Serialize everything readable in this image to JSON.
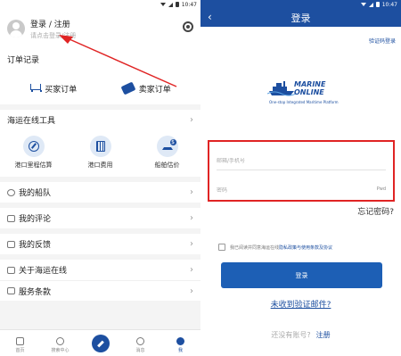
{
  "status_bar": {
    "time": "10:47"
  },
  "left": {
    "profile": {
      "login_label": "登录 / 注册",
      "hint": "请点击登录/注册"
    },
    "orders": {
      "title": "订单记录",
      "buy_label": "买家订单",
      "sell_label": "卖家订单"
    },
    "tools": {
      "title": "海运在线工具",
      "items": [
        {
          "label": "港口里程估算",
          "icon": "compass-icon"
        },
        {
          "label": "港口费用",
          "icon": "calculator-icon"
        },
        {
          "label": "船舶估价",
          "icon": "ship-price-icon"
        }
      ]
    },
    "menu": {
      "fleet": "我的船队",
      "reviews": "我的评论",
      "feedback": "我的反馈",
      "about": "关于海运在线",
      "terms": "服务条款"
    },
    "nav": [
      {
        "label": "首页",
        "icon": "home-icon"
      },
      {
        "label": "搜索中心",
        "icon": "headset-icon"
      },
      {
        "label": "",
        "icon": "center-action-icon"
      },
      {
        "label": "消息",
        "icon": "message-icon"
      },
      {
        "label": "我",
        "icon": "profile-icon"
      }
    ]
  },
  "right": {
    "title": "登录",
    "code_login": "验证码登录",
    "logo": {
      "line1": "MARINE",
      "line2": "ONLINE",
      "tagline": "One-stop Integrated Maritime Platform"
    },
    "email_placeholder": "邮箱/手机号",
    "password_placeholder": "密码",
    "password_toggle": "Pwd",
    "forgot": "忘记密码?",
    "agree_prefix": "我已阅读并同意海运在线",
    "agree_link": "隐私政策与使用条款及协议",
    "login_button": "登录",
    "no_code": "未收到验证邮件?",
    "no_account": "还没有账号?",
    "register": "注册"
  },
  "colors": {
    "brand": "#1d4fa0",
    "button": "#1d5fb5",
    "highlight_box": "#e02424"
  }
}
